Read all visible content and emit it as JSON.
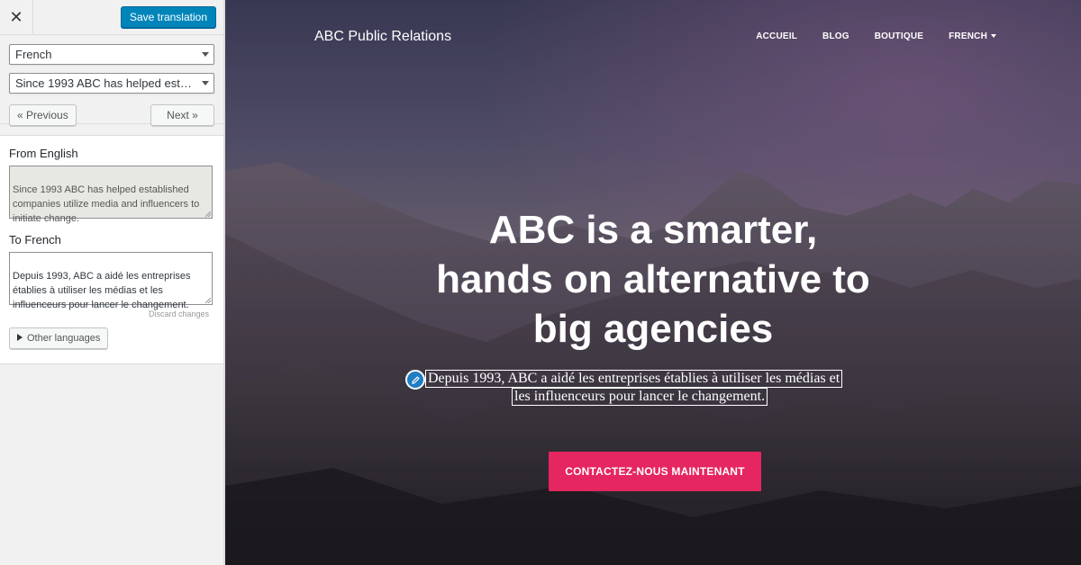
{
  "sidebar": {
    "save_label": "Save translation",
    "language_select": "French",
    "string_select": "Since 1993 ABC has helped esta...",
    "previous_label": "« Previous",
    "next_label": "Next »",
    "from_label": "From English",
    "from_text": "Since 1993 ABC has helped established companies utilize media and influencers to initiate change.",
    "to_label": "To French",
    "to_text": "Depuis 1993, ABC a aidé les entreprises établies à utiliser les médias et les influenceurs pour lancer le changement.",
    "discard_label": "Discard changes",
    "other_languages_label": "Other languages"
  },
  "preview": {
    "site_name": "ABC Public Relations",
    "menu": [
      "ACCUEIL",
      "BLOG",
      "BOUTIQUE",
      "FRENCH"
    ],
    "hero_title": "ABC is a smarter,\nhands on alternative to\nbig agencies",
    "subtitle_line1": "Depuis 1993, ABC a aidé les entreprises établies à utiliser les médias et",
    "subtitle_line2": "les influenceurs pour lancer le changement.",
    "cta_label": "CONTACTEZ-NOUS MAINTENANT"
  },
  "colors": {
    "save_button": "#0085ba",
    "cta": "#e62660",
    "edit_icon": "#1f7dc4"
  },
  "icons": [
    "close-icon",
    "dropdown-arrow-icon",
    "triangle-right-icon",
    "pencil-icon",
    "caret-down-icon"
  ]
}
